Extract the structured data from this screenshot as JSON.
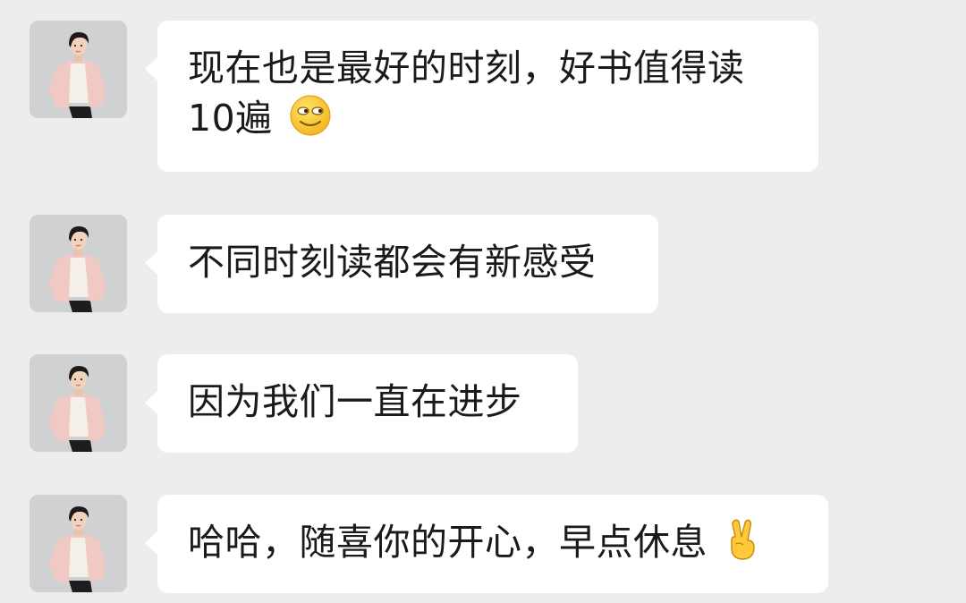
{
  "messages": [
    {
      "avatar_icon": "contact-avatar-woman",
      "text_line1": "现在也是最好的时刻，好书值得读",
      "text_line2": "10遍",
      "emoji": "smirk-face-icon"
    },
    {
      "avatar_icon": "contact-avatar-woman",
      "text": "不同时刻读都会有新感受"
    },
    {
      "avatar_icon": "contact-avatar-woman",
      "text": "因为我们一直在进步"
    },
    {
      "avatar_icon": "contact-avatar-woman",
      "text": "哈哈，随喜你的开心，早点休息",
      "emoji": "victory-hand-icon"
    }
  ],
  "colors": {
    "background": "#ededed",
    "bubble": "#ffffff",
    "text": "#1a1a1a"
  }
}
